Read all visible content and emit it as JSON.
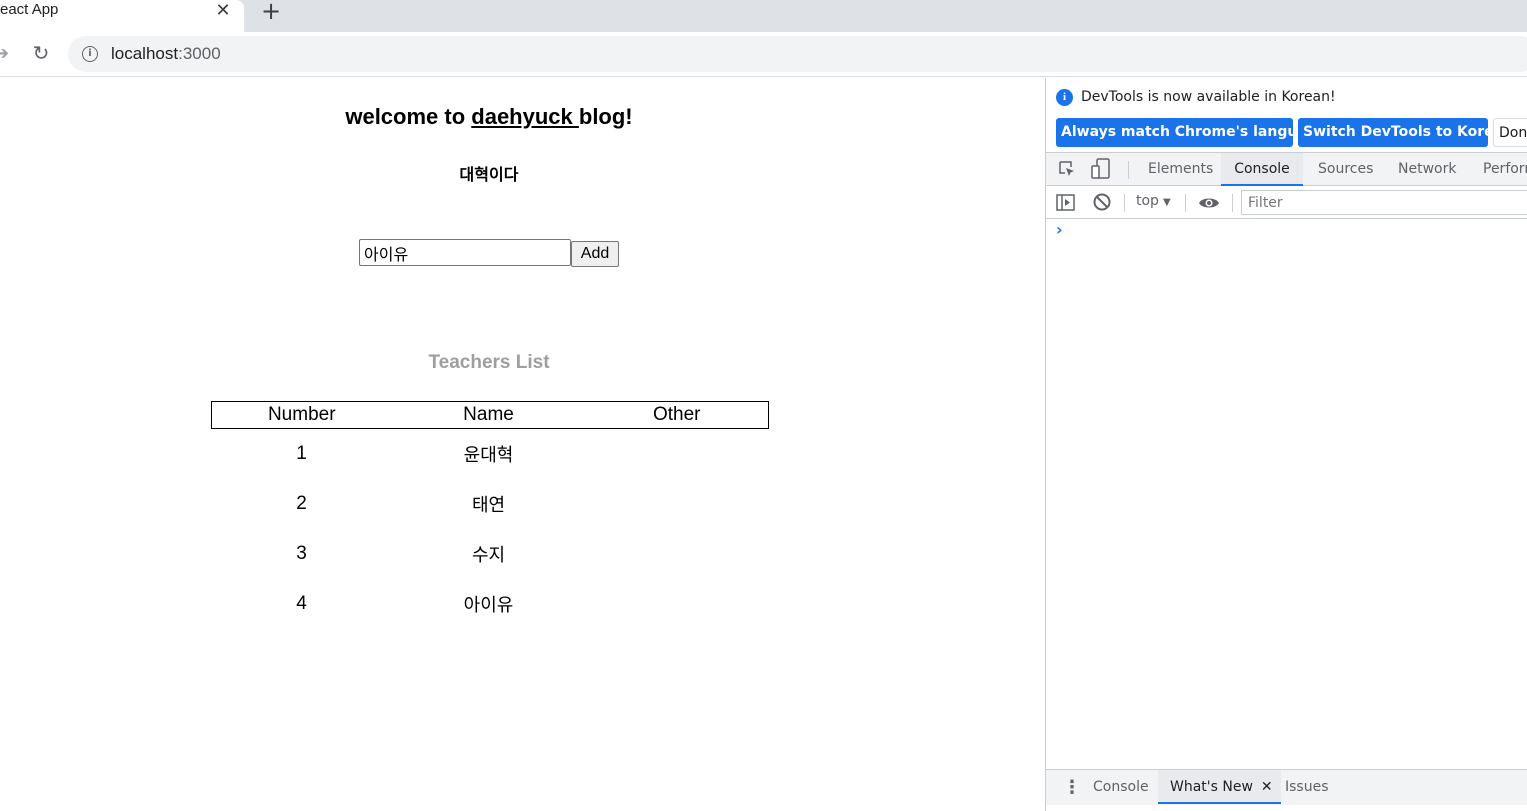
{
  "browser": {
    "tab_title": "eact App",
    "tab_close": "✕",
    "new_tab": "+",
    "url_host": "localhost",
    "url_port": ":3000"
  },
  "page": {
    "heading_prefix": "welcome to ",
    "heading_link": "daehyuck ",
    "heading_suffix": "blog!",
    "subheading": "대혁이다",
    "input_value": "아이유",
    "add_button": "Add",
    "list_title": "Teachers List",
    "table": {
      "headers": [
        "Number",
        "Name",
        "Other"
      ],
      "rows": [
        {
          "number": "1",
          "name": "윤대혁",
          "other": ""
        },
        {
          "number": "2",
          "name": "태연",
          "other": ""
        },
        {
          "number": "3",
          "name": "수지",
          "other": ""
        },
        {
          "number": "4",
          "name": "아이유",
          "other": ""
        }
      ]
    }
  },
  "devtools": {
    "info_message": "DevTools is now available in Korean!",
    "info_badge": "i",
    "match_language_button": "Always match Chrome's language",
    "switch_korean_button": "Switch DevTools to Korean",
    "dont_show_button": "Don't show again",
    "tabs": [
      "Elements",
      "Console",
      "Sources",
      "Network",
      "Performance"
    ],
    "context": "top",
    "filter_placeholder": "Filter",
    "prompt": "›",
    "drawer_tabs": [
      "Console",
      "What's New",
      "Issues"
    ],
    "drawer_close": "✕",
    "accent_color": "#1a73e8"
  }
}
